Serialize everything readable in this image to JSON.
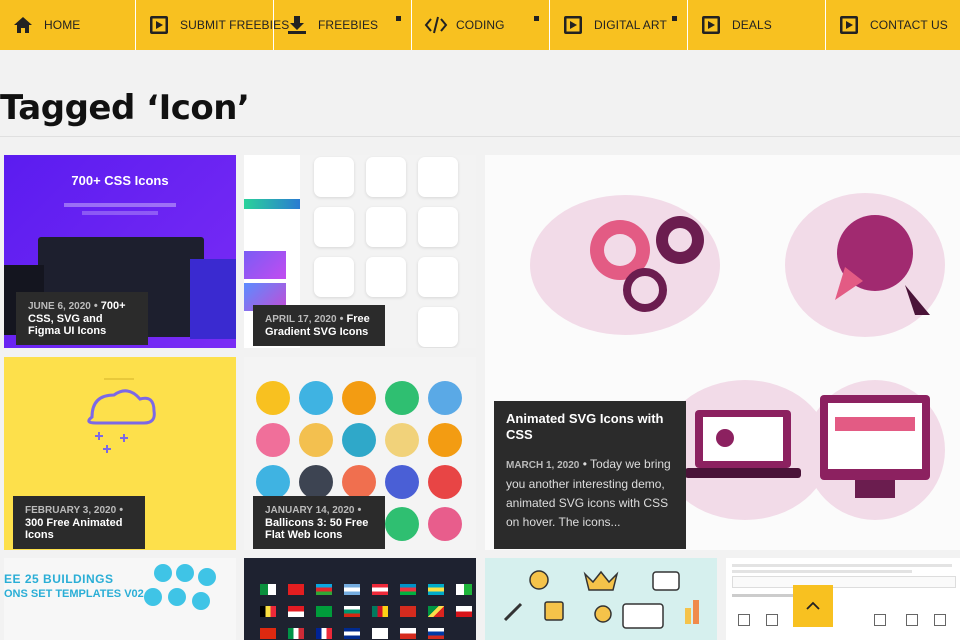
{
  "nav": [
    {
      "label": "HOME",
      "icon": "home-icon",
      "dot": false
    },
    {
      "label": "SUBMIT FREEBIES",
      "icon": "play-square-icon",
      "dot": false
    },
    {
      "label": "FREEBIES",
      "icon": "download-icon",
      "dot": true
    },
    {
      "label": "CODING",
      "icon": "code-icon",
      "dot": true
    },
    {
      "label": "DIGITAL ART",
      "icon": "play-square-icon",
      "dot": true
    },
    {
      "label": "DEALS",
      "icon": "play-square-icon",
      "dot": false
    },
    {
      "label": "CONTACT US",
      "icon": "play-square-icon",
      "dot": false
    }
  ],
  "page_title": "Tagged ‘Icon’",
  "posts": [
    {
      "date": "JUNE 6, 2020",
      "title": "700+ CSS, SVG and Figma UI Icons",
      "thumb_heading": "700+ CSS Icons"
    },
    {
      "date": "APRIL 17, 2020",
      "title": "Free Gradient SVG Icons"
    },
    {
      "date": "FEBRUARY 3, 2020",
      "title": "300 Free Animated Icons"
    },
    {
      "date": "JANUARY 14, 2020",
      "title": "Ballicons 3: 50 Free Flat Web Icons"
    },
    {
      "date": "MARCH 1, 2020",
      "title": "Animated SVG Icons with CSS",
      "excerpt": "Today we bring you another interesting demo, animated SVG icons with CSS on hover. The icons..."
    }
  ],
  "bottom_row": [
    {
      "thumb_text_1": "EE 25 BUILDINGS",
      "thumb_text_2": "ONS SET TEMPLATES V02"
    }
  ],
  "scroll_top_icon": "chevron-up-icon",
  "colors": {
    "accent": "#f8c120",
    "caption_bg": "#2b2b2b"
  }
}
